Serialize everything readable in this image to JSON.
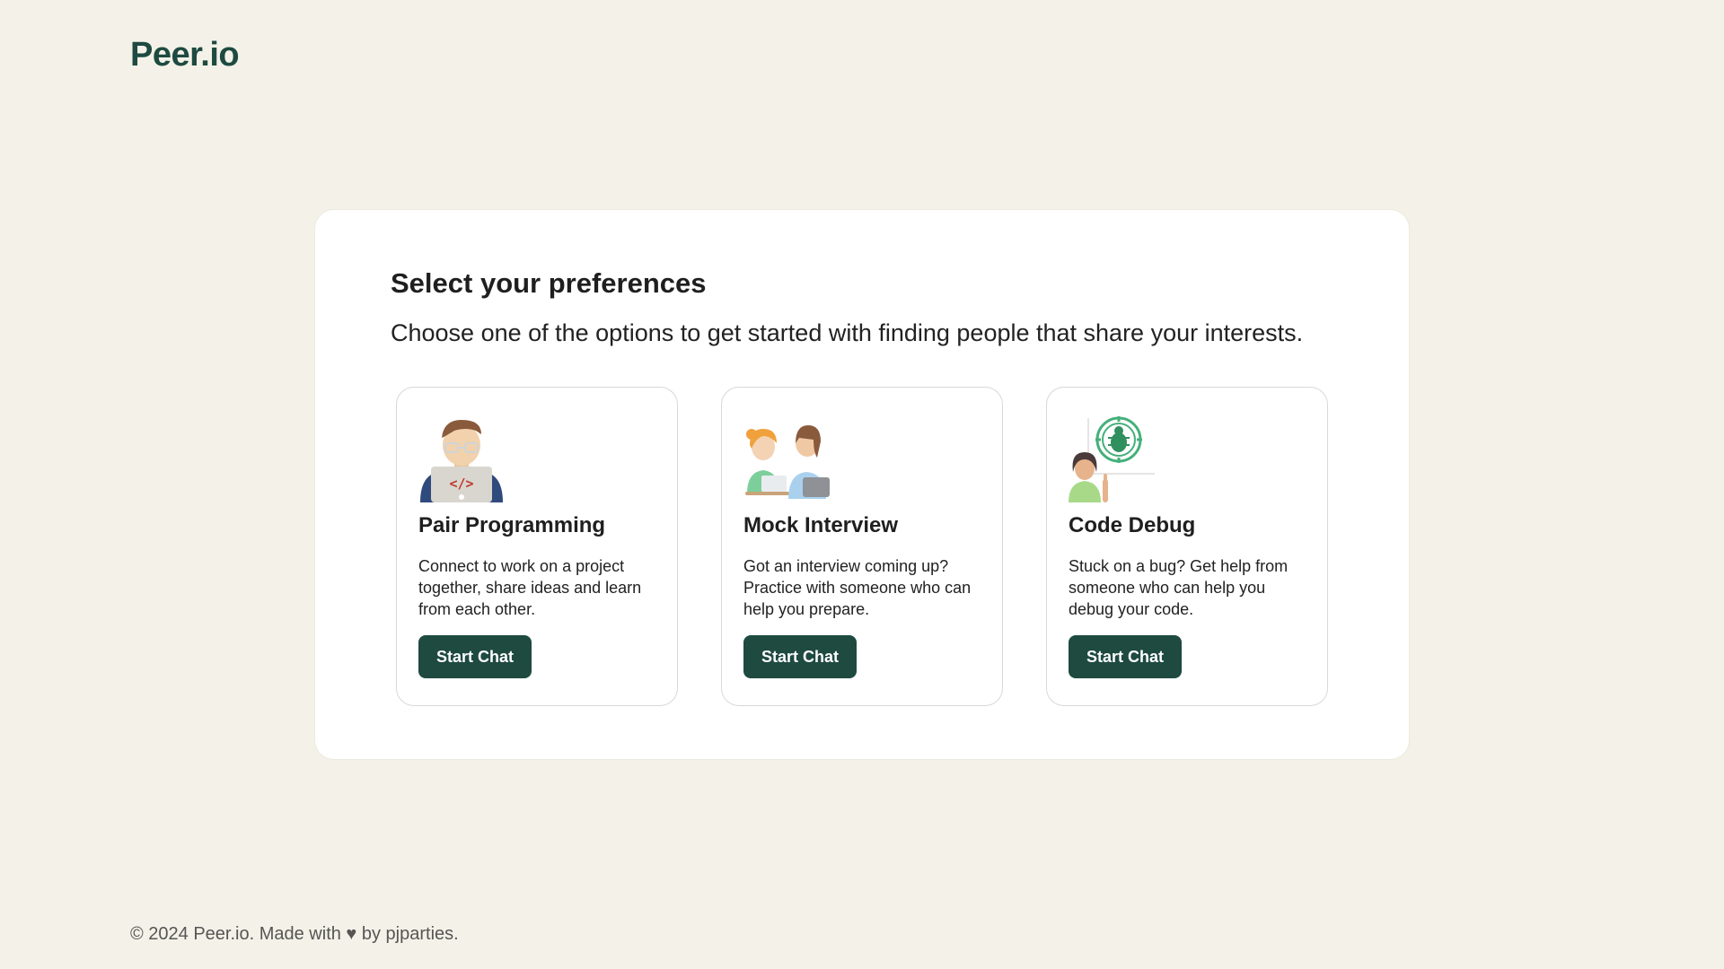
{
  "header": {
    "logo": "Peer.io"
  },
  "main": {
    "title": "Select your preferences",
    "subtitle": "Choose one of the options to get started with finding people that share your interests.",
    "cards": [
      {
        "icon": "developer-laptop-icon",
        "title": "Pair Programming",
        "description": "Connect to work on a project together, share ideas and learn from each other.",
        "button": "Start Chat"
      },
      {
        "icon": "interview-people-icon",
        "title": "Mock Interview",
        "description": "Got an interview coming up? Practice with someone who can help you prepare.",
        "button": "Start Chat"
      },
      {
        "icon": "bug-target-icon",
        "title": "Code Debug",
        "description": "Stuck on a bug? Get help from someone who can help you debug your code.",
        "button": "Start Chat"
      }
    ]
  },
  "footer": {
    "text": "© 2024 Peer.io. Made with ♥ by pjparties."
  },
  "colors": {
    "background": "#f4f2e8",
    "brand": "#1e4a40",
    "card_border": "#d8d8d8"
  }
}
